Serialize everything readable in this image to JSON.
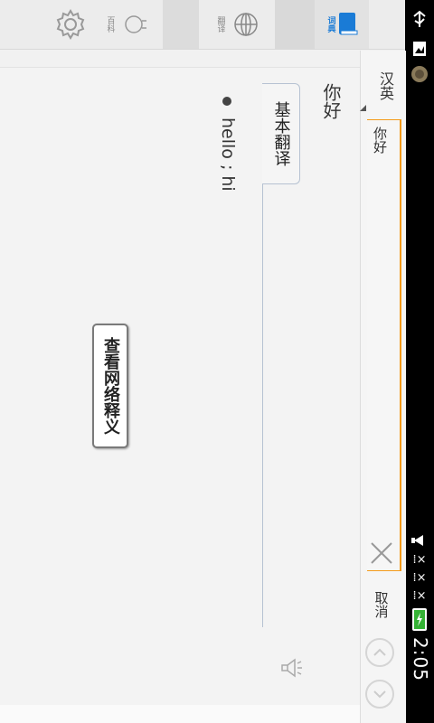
{
  "status_bar": {
    "time": "下午 2:05",
    "icons": [
      "usb-icon",
      "image-icon",
      "record-icon",
      "mute-icon",
      "signal-x-icon",
      "signal-x-icon",
      "signal-x-icon",
      "battery-charging-icon"
    ]
  },
  "toolbar": {
    "tabs": [
      {
        "label": "词典",
        "icon": "book-icon",
        "active": true,
        "color": "#1a7bd6"
      },
      {
        "label": "翻译",
        "icon": "globe-icon",
        "active": false
      },
      {
        "label": "百科",
        "icon": "lightbulb-icon",
        "active": false
      },
      {
        "label": "",
        "icon": "gear-icon",
        "active": false
      }
    ]
  },
  "search": {
    "direction": "汉英",
    "query": "你好",
    "cancel_label": "取消",
    "accent": "#f49b1a"
  },
  "result": {
    "word": "你好",
    "tab_label": "基本翻译",
    "meanings": [
      "hello ; hi"
    ],
    "network_button": "查看网络释义"
  }
}
